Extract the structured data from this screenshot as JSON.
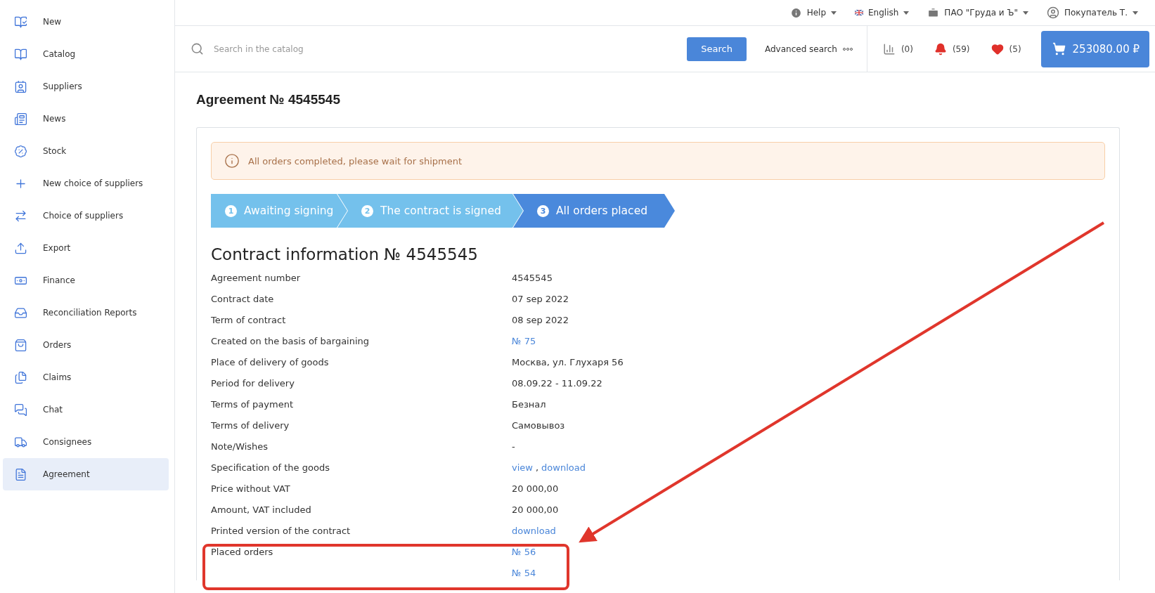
{
  "sidebar": {
    "items": [
      {
        "label": "New",
        "selected": false
      },
      {
        "label": "Catalog",
        "selected": false
      },
      {
        "label": "Suppliers",
        "selected": false
      },
      {
        "label": "News",
        "selected": false
      },
      {
        "label": "Stock",
        "selected": false
      },
      {
        "label": "New choice of suppliers",
        "selected": false
      },
      {
        "label": "Choice of suppliers",
        "selected": false
      },
      {
        "label": "Export",
        "selected": false
      },
      {
        "label": "Finance",
        "selected": false
      },
      {
        "label": "Reconciliation Reports",
        "selected": false
      },
      {
        "label": "Orders",
        "selected": false
      },
      {
        "label": "Claims",
        "selected": false
      },
      {
        "label": "Chat",
        "selected": false
      },
      {
        "label": "Consignees",
        "selected": false
      },
      {
        "label": "Agreement",
        "selected": true
      }
    ]
  },
  "top_bar": {
    "help": "Help",
    "language": "English",
    "company": "ПАО \"Груда и Ъ\"",
    "user": "Покупатель Т."
  },
  "search": {
    "placeholder": "Search in the catalog",
    "button": "Search",
    "advanced": "Advanced search"
  },
  "counters": {
    "compare": "(0)",
    "notifications": "(59)",
    "favorites": "(5)"
  },
  "cart": {
    "total": "253080.00 ₽"
  },
  "page_title": "Agreement № 4545545",
  "alert": "All orders completed, please wait for shipment",
  "steps": [
    {
      "number": "1",
      "label": "Awaiting signing",
      "selected": false
    },
    {
      "number": "2",
      "label": "The contract is signed",
      "selected": false
    },
    {
      "number": "3",
      "label": "All orders placed",
      "selected": true
    }
  ],
  "contract": {
    "heading": "Contract information № 4545545",
    "rows": [
      {
        "label": "Agreement number",
        "lines": [
          [
            {
              "text": "4545545",
              "kind": "text"
            }
          ]
        ]
      },
      {
        "label": "Contract date",
        "lines": [
          [
            {
              "text": "07 sep 2022",
              "kind": "text"
            }
          ]
        ]
      },
      {
        "label": "Term of contract",
        "lines": [
          [
            {
              "text": "08 sep 2022",
              "kind": "text"
            }
          ]
        ]
      },
      {
        "label": "Created on the basis of bargaining",
        "lines": [
          [
            {
              "text": "№ 75",
              "kind": "link"
            }
          ]
        ]
      },
      {
        "label": "Place of delivery of goods",
        "lines": [
          [
            {
              "text": "Москва, ул. Глухаря 56",
              "kind": "text"
            }
          ]
        ]
      },
      {
        "label": "Period for delivery",
        "lines": [
          [
            {
              "text": "08.09.22 - 11.09.22",
              "kind": "text"
            }
          ]
        ]
      },
      {
        "label": "Terms of payment",
        "lines": [
          [
            {
              "text": "Безнал",
              "kind": "text"
            }
          ]
        ]
      },
      {
        "label": "Terms of delivery",
        "lines": [
          [
            {
              "text": "Самовывоз",
              "kind": "text"
            }
          ]
        ]
      },
      {
        "label": "Note/Wishes",
        "lines": [
          [
            {
              "text": "-",
              "kind": "text"
            }
          ]
        ]
      },
      {
        "label": "Specification of the goods",
        "lines": [
          [
            {
              "text": "view",
              "kind": "link"
            },
            {
              "text": ",",
              "kind": "text"
            },
            {
              "text": "download",
              "kind": "link"
            }
          ]
        ]
      },
      {
        "label": "Price without VAT",
        "lines": [
          [
            {
              "text": "20 000,00",
              "kind": "text"
            }
          ]
        ]
      },
      {
        "label": "Amount, VAT included",
        "lines": [
          [
            {
              "text": "20 000,00",
              "kind": "text"
            }
          ]
        ]
      },
      {
        "label": "Printed version of the contract",
        "lines": [
          [
            {
              "text": "download",
              "kind": "link"
            }
          ]
        ]
      },
      {
        "label": "Placed orders",
        "lines": [
          [
            {
              "text": "№ 56",
              "kind": "link"
            }
          ],
          [
            {
              "text": "№ 54",
              "kind": "link"
            }
          ]
        ]
      }
    ]
  }
}
